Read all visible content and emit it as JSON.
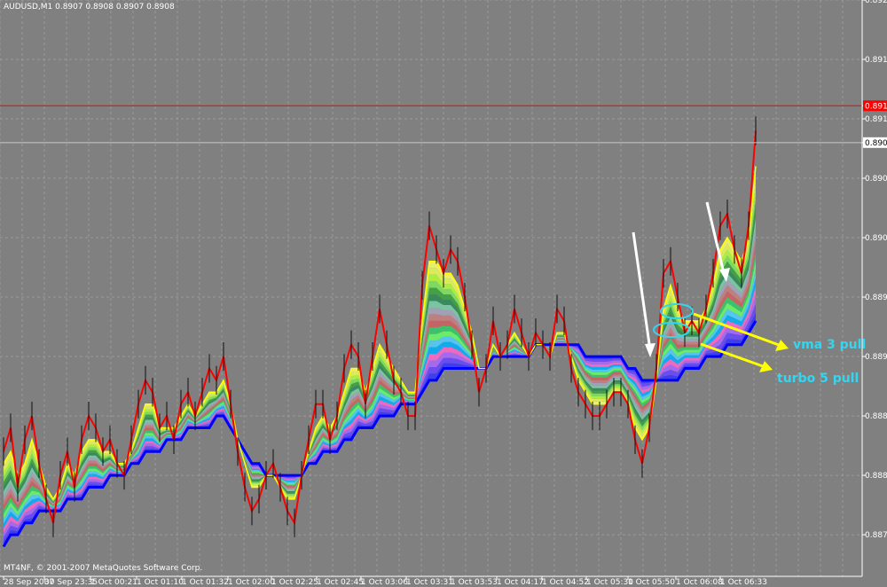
{
  "header": {
    "title": "AUDUSD,M1 0.8907 0.8908 0.8907 0.8908"
  },
  "footer": {
    "copyright": "MT4NF, © 2001-2007 MetaQuotes Software Corp."
  },
  "colors": {
    "background": "#808080",
    "grid": "#9a9a9a",
    "axis_text": "#ffffff",
    "price_ma": "#ff0000",
    "ask_line": "#ff0000",
    "bid_line": "#c8c8c8",
    "annotation_arrow": "#ffff00",
    "annotation_text": "#33d6f0",
    "hint_arrow": "#ffffff"
  },
  "annotations": {
    "vma": "vma 3 pull",
    "turbo": "turbo 5 pull"
  },
  "chart_data": {
    "type": "line",
    "title": "AUDUSD,M1 0.8907 0.8908 0.8907 0.8908",
    "xlabel": "",
    "ylabel": "",
    "ylim": [
      0.88715,
      0.892
    ],
    "yticks": [
      "0.8920",
      "0.8915",
      "0.8911",
      "0.8910",
      "0.8908",
      "0.8905",
      "0.8900",
      "0.8895",
      "0.8890",
      "0.8885",
      "0.8880",
      "0.8875"
    ],
    "ytick_values": [
      0.892,
      0.8915,
      0.89111,
      0.891,
      0.8908,
      0.8905,
      0.89,
      0.8895,
      0.889,
      0.8885,
      0.888,
      0.8875
    ],
    "xticks": [
      "28 Sep 2007",
      "30 Sep 23:35",
      "1 Oct 00:21",
      "1 Oct 01:10",
      "1 Oct 01:32",
      "1 Oct 02:00",
      "1 Oct 02:25",
      "1 Oct 02:45",
      "1 Oct 03:06",
      "1 Oct 03:31",
      "1 Oct 03:53",
      "1 Oct 04:17",
      "1 Oct 04:52",
      "1 Oct 05:30",
      "1 Oct 05:50",
      "1 Oct 06:08",
      "1 Oct 06:33"
    ],
    "ask_price": 0.89111,
    "bid_price": 0.8908,
    "grid": true,
    "legend": "none",
    "series": [
      {
        "name": "",
        "role": "price",
        "color": "#ff0000",
        "values": [
          0.8882,
          0.8884,
          0.8879,
          0.8883,
          0.8885,
          0.8881,
          0.8878,
          0.8876,
          0.888,
          0.8882,
          0.8879,
          0.8883,
          0.8885,
          0.8884,
          0.8882,
          0.8883,
          0.8881,
          0.888,
          0.8883,
          0.8886,
          0.8888,
          0.8887,
          0.8884,
          0.8885,
          0.8883,
          0.8886,
          0.8887,
          0.8885,
          0.8887,
          0.8889,
          0.8888,
          0.889,
          0.8886,
          0.8882,
          0.8879,
          0.8877,
          0.8878,
          0.888,
          0.8881,
          0.8879,
          0.8877,
          0.8876,
          0.888,
          0.8883,
          0.8886,
          0.8886,
          0.8883,
          0.8885,
          0.8889,
          0.8891,
          0.889,
          0.8886,
          0.889,
          0.8894,
          0.8891,
          0.8888,
          0.8887,
          0.8885,
          0.8885,
          0.8896,
          0.8901,
          0.8899,
          0.8897,
          0.8899,
          0.8898,
          0.8895,
          0.8891,
          0.8887,
          0.8889,
          0.8893,
          0.889,
          0.8891,
          0.8894,
          0.8892,
          0.889,
          0.8892,
          0.8891,
          0.889,
          0.8894,
          0.8893,
          0.8889,
          0.8887,
          0.8886,
          0.8885,
          0.8885,
          0.8886,
          0.8887,
          0.8887,
          0.8886,
          0.8883,
          0.8881,
          0.8884,
          0.8889,
          0.8897,
          0.8898,
          0.8895,
          0.8892,
          0.8893,
          0.8892,
          0.8894,
          0.8897,
          0.8901,
          0.8902,
          0.8899,
          0.8897,
          0.8901,
          0.8909
        ]
      },
      {
        "name": "",
        "role": "fast MA",
        "color": "#ffff00",
        "values": [
          0.8881,
          0.8882,
          0.888,
          0.8881,
          0.8883,
          0.8881,
          0.8879,
          0.8878,
          0.8879,
          0.8881,
          0.888,
          0.8882,
          0.8883,
          0.8883,
          0.8882,
          0.8882,
          0.8881,
          0.8881,
          0.8882,
          0.8884,
          0.8886,
          0.8886,
          0.8884,
          0.8884,
          0.8884,
          0.8885,
          0.8886,
          0.8885,
          0.8886,
          0.8887,
          0.8887,
          0.8888,
          0.8886,
          0.8883,
          0.8881,
          0.8879,
          0.8879,
          0.888,
          0.888,
          0.8879,
          0.8878,
          0.8878,
          0.888,
          0.8882,
          0.8884,
          0.8885,
          0.8884,
          0.8885,
          0.8887,
          0.8889,
          0.8889,
          0.8887,
          0.8889,
          0.8891,
          0.889,
          0.8889,
          0.8888,
          0.8887,
          0.8887,
          0.8893,
          0.8898,
          0.8898,
          0.8897,
          0.8897,
          0.8896,
          0.8894,
          0.8892,
          0.8889,
          0.8889,
          0.8891,
          0.889,
          0.8891,
          0.8892,
          0.8891,
          0.889,
          0.8891,
          0.8891,
          0.889,
          0.8892,
          0.8892,
          0.889,
          0.8888,
          0.8887,
          0.8886,
          0.8886,
          0.8886,
          0.8887,
          0.8887,
          0.8886,
          0.8884,
          0.8883,
          0.8884,
          0.8888,
          0.8894,
          0.8896,
          0.8894,
          0.8893,
          0.8893,
          0.8893,
          0.8894,
          0.8896,
          0.8899,
          0.89,
          0.8899,
          0.8898,
          0.89,
          0.8906
        ]
      },
      {
        "name": "",
        "role": "slow MA",
        "color": "#0000ff",
        "values": [
          0.8874,
          0.8875,
          0.8875,
          0.8876,
          0.8876,
          0.8877,
          0.8877,
          0.8877,
          0.8877,
          0.8878,
          0.8878,
          0.8878,
          0.8879,
          0.8879,
          0.8879,
          0.888,
          0.888,
          0.888,
          0.8881,
          0.8881,
          0.8882,
          0.8882,
          0.8882,
          0.8883,
          0.8883,
          0.8883,
          0.8884,
          0.8884,
          0.8884,
          0.8884,
          0.8885,
          0.8885,
          0.8884,
          0.8883,
          0.8882,
          0.8881,
          0.8881,
          0.888,
          0.888,
          0.888,
          0.888,
          0.888,
          0.888,
          0.8881,
          0.8881,
          0.8882,
          0.8882,
          0.8882,
          0.8883,
          0.8883,
          0.8884,
          0.8884,
          0.8884,
          0.8885,
          0.8885,
          0.8885,
          0.8886,
          0.8886,
          0.8886,
          0.8887,
          0.8888,
          0.8888,
          0.8889,
          0.8889,
          0.8889,
          0.8889,
          0.8889,
          0.8889,
          0.8889,
          0.889,
          0.889,
          0.889,
          0.889,
          0.889,
          0.889,
          0.8891,
          0.8891,
          0.8891,
          0.8891,
          0.8891,
          0.8891,
          0.8891,
          0.889,
          0.889,
          0.889,
          0.889,
          0.889,
          0.889,
          0.8889,
          0.8889,
          0.8888,
          0.8888,
          0.8888,
          0.8888,
          0.8888,
          0.8888,
          0.8889,
          0.8889,
          0.8889,
          0.889,
          0.889,
          0.889,
          0.8891,
          0.8891,
          0.8891,
          0.8892,
          0.8893
        ]
      }
    ]
  }
}
